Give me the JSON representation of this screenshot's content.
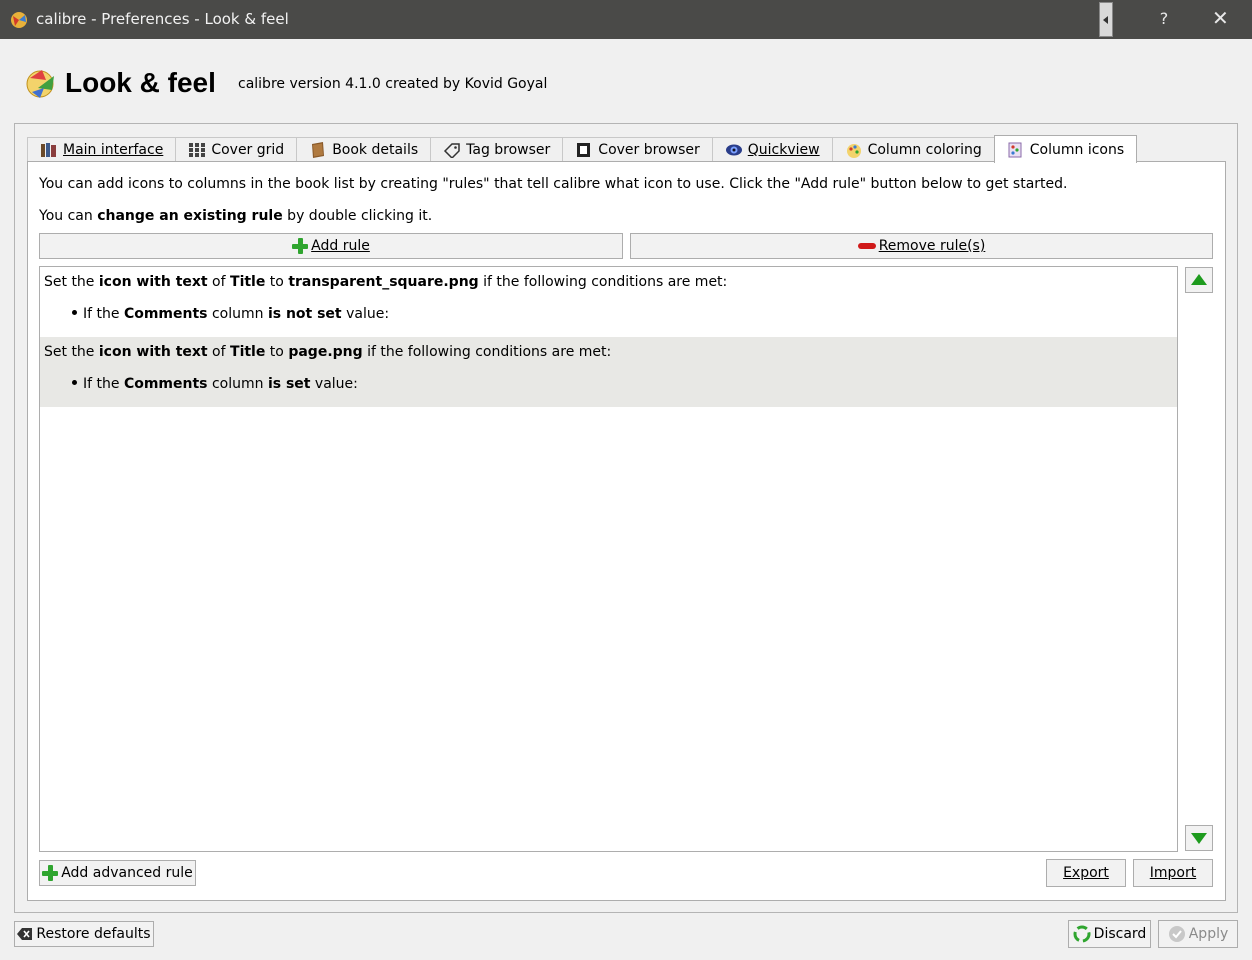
{
  "window": {
    "title": "calibre - Preferences - Look & feel",
    "help_glyph": "?",
    "close_glyph": "✕"
  },
  "header": {
    "title": "Look & feel",
    "subtitle": "calibre version 4.1.0 created by Kovid Goyal"
  },
  "tabs": [
    {
      "label": "Main interface",
      "icon": "books-icon"
    },
    {
      "label": "Cover grid",
      "icon": "grid-icon"
    },
    {
      "label": "Book details",
      "icon": "book-icon"
    },
    {
      "label": "Tag browser",
      "icon": "tag-icon"
    },
    {
      "label": "Cover browser",
      "icon": "cover-icon"
    },
    {
      "label": "Quickview",
      "icon": "eye-icon"
    },
    {
      "label": "Column coloring",
      "icon": "palette-icon"
    },
    {
      "label": "Column icons",
      "icon": "column-icons-icon",
      "active": true
    }
  ],
  "content": {
    "desc1": "You can add icons to columns in the book list by creating \"rules\" that tell calibre what icon to use. Click the \"Add rule\" button below to get started.",
    "desc2_pre": "You can ",
    "desc2_bold": "change an existing rule",
    "desc2_post": " by double clicking it.",
    "add_rule": "Add rule",
    "remove_rule": "Remove rule(s)"
  },
  "rules": [
    {
      "set": "Set the ",
      "kind": "icon with text",
      "of": " of ",
      "column": "Title",
      "to": " to ",
      "file": "transparent_square.png",
      "tail": " if the following conditions are met:",
      "cond_if": "If the ",
      "cond_col": "Comments",
      "cond_mid": " column ",
      "cond_op": "is not set",
      "cond_end": " value:"
    },
    {
      "set": "Set the ",
      "kind": "icon with text",
      "of": " of ",
      "column": "Title",
      "to": " to ",
      "file": "page.png",
      "tail": " if the following conditions are met:",
      "cond_if": "If the ",
      "cond_col": "Comments",
      "cond_mid": " column ",
      "cond_op": "is set",
      "cond_end": " value:"
    }
  ],
  "bottom": {
    "add_advanced": "Add advanced rule",
    "export": "Export",
    "import": "Import"
  },
  "footer": {
    "restore": "Restore defaults",
    "discard": "Discard",
    "apply": "Apply"
  },
  "colors": {
    "titlebar": "#4a4a48",
    "accent_green": "#2fa52f",
    "remove_red": "#d01a1a",
    "selected_row": "#e8e8e5"
  }
}
